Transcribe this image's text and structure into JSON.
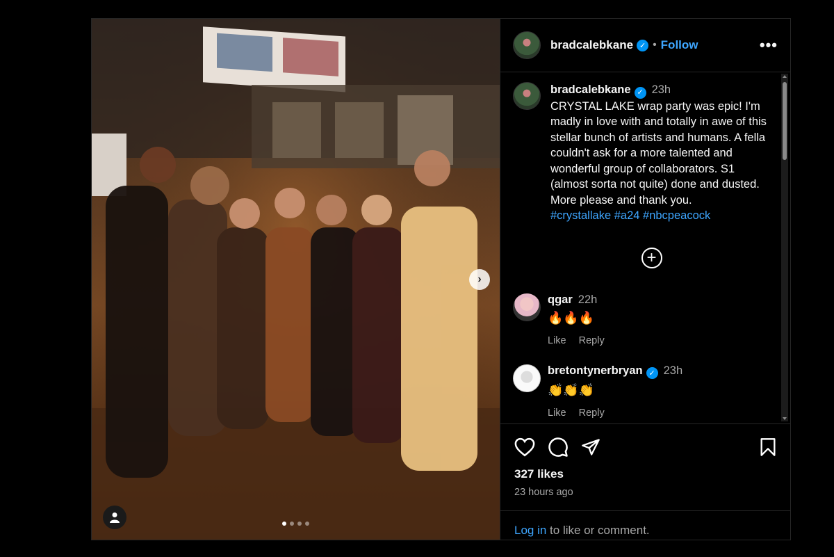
{
  "post": {
    "username": "bradcalebkane",
    "follow_label": "Follow",
    "separator": "•",
    "more_label": "•••",
    "verified_mark": "✓"
  },
  "caption": {
    "username": "bradcalebkane",
    "time": "23h",
    "text": "CRYSTAL LAKE wrap party was epic! I'm madly in love with and totally in awe of this stellar bunch of artists and humans. A fella couldn't ask for a more talented and wonderful group of collaborators. S1 (almost sorta not quite) done and dusted. More please and thank you.",
    "hashtags": [
      "#crystallake",
      "#a24",
      "#nbcpeacock"
    ]
  },
  "comments": [
    {
      "username": "qgar",
      "time": "22h",
      "text": "🔥🔥🔥",
      "like_label": "Like",
      "reply_label": "Reply",
      "verified": false
    },
    {
      "username": "bretontynerbryan",
      "time": "23h",
      "text": "👏👏👏",
      "like_label": "Like",
      "reply_label": "Reply",
      "verified": true
    }
  ],
  "engagement": {
    "likes": "327 likes",
    "time_ago": "23 hours ago"
  },
  "login": {
    "link": "Log in",
    "rest": " to like or comment."
  },
  "carousel": {
    "count": 4,
    "active": 0,
    "next_label": "›"
  },
  "icons": {
    "like": "heart-icon",
    "comment": "comment-icon",
    "share": "share-icon",
    "save": "bookmark-icon",
    "tag": "user-tag-icon",
    "add": "plus-circle-icon"
  },
  "colors": {
    "accent": "#3ea6ff",
    "verified": "#0095f6",
    "background": "#000000"
  }
}
